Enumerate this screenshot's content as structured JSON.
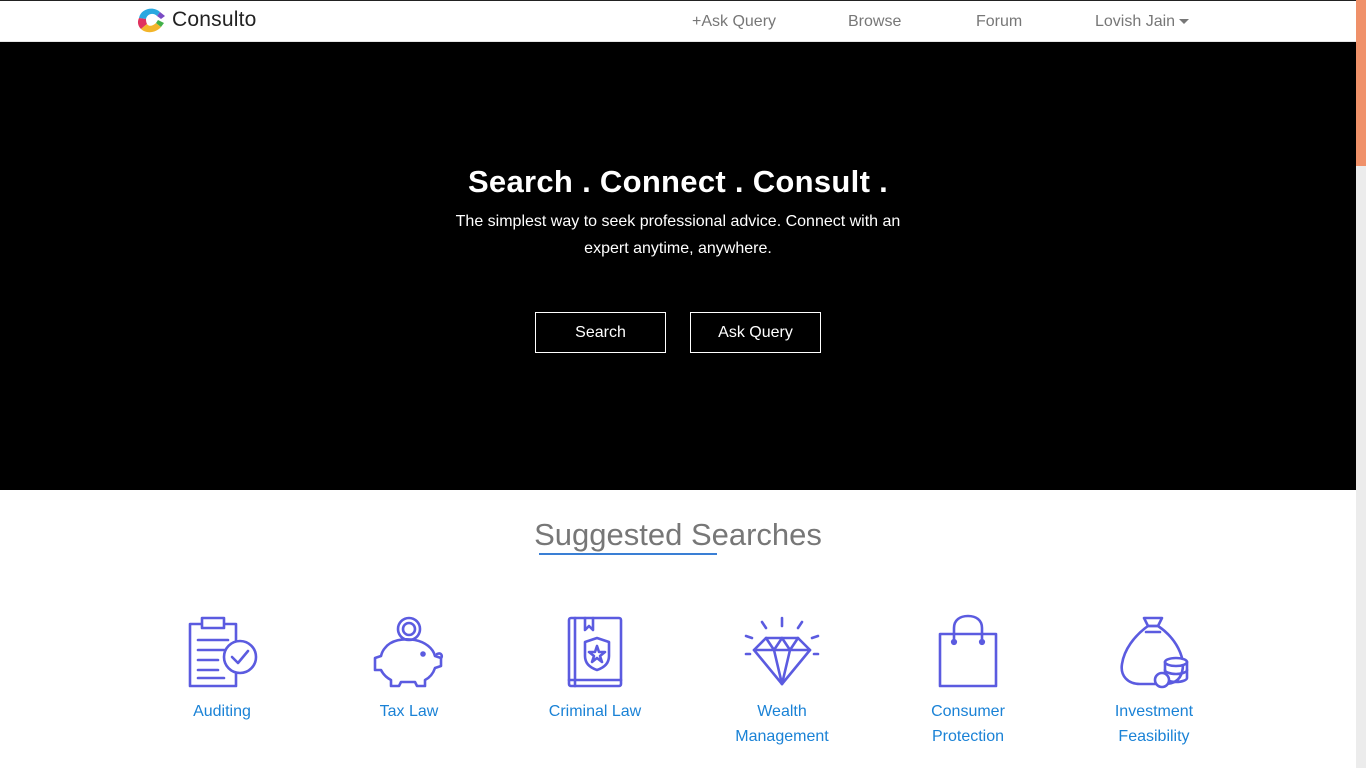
{
  "brand": {
    "name": "Consulto",
    "logo": "consulto-logo-icon"
  },
  "nav": {
    "ask_query": "+Ask Query",
    "browse": "Browse",
    "forum": "Forum",
    "user": "Lovish Jain"
  },
  "hero": {
    "title": "Search . Connect . Consult .",
    "subtitle": "The simplest way to seek professional advice. Connect with an expert anytime, anywhere.",
    "search_button": "Search",
    "ask_button": "Ask Query"
  },
  "suggested": {
    "title": "Suggested Searches",
    "categories": [
      {
        "label": "Auditing",
        "icon": "clipboard-check-icon"
      },
      {
        "label": "Tax Law",
        "icon": "piggy-bank-icon"
      },
      {
        "label": "Criminal Law",
        "icon": "law-book-icon"
      },
      {
        "label": "Wealth Management",
        "icon": "diamond-icon"
      },
      {
        "label": "Consumer Protection",
        "icon": "shopping-bag-icon"
      },
      {
        "label": "Investment Feasibility",
        "icon": "money-bag-icon"
      }
    ]
  },
  "colors": {
    "accent": "#1a82d6",
    "icon": "#5b5be0",
    "hero_bg": "#000000",
    "underline": "#3a7fd5",
    "scroll_thumb": "#f0916a"
  }
}
